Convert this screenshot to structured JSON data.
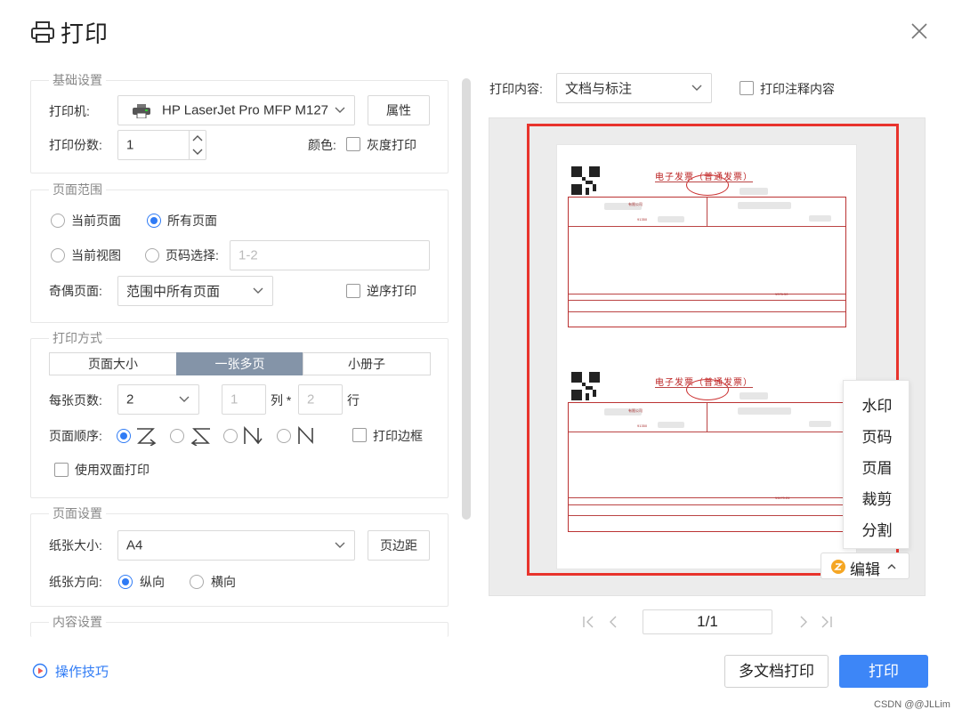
{
  "header": {
    "title": "打印",
    "close_icon": "close-icon"
  },
  "basic": {
    "legend": "基础设置",
    "printer_label": "打印机:",
    "printer_value": "HP LaserJet Pro MFP M127",
    "properties_button": "属性",
    "copies_label": "打印份数:",
    "copies_value": "1",
    "color_label": "颜色:",
    "grayscale_label": "灰度打印",
    "grayscale_checked": false
  },
  "range": {
    "legend": "页面范围",
    "current_page": "当前页面",
    "all_pages": "所有页面",
    "selected": "all_pages",
    "current_view": "当前视图",
    "page_select": "页码选择:",
    "page_select_placeholder": "1-2",
    "odd_even_label": "奇偶页面:",
    "odd_even_value": "范围中所有页面",
    "reverse_label": "逆序打印",
    "reverse_checked": false
  },
  "method": {
    "legend": "打印方式",
    "tabs": [
      "页面大小",
      "一张多页",
      "小册子"
    ],
    "active_tab": "一张多页",
    "per_sheet_label": "每张页数:",
    "per_sheet_value": "2",
    "cols_value": "1",
    "cols_label": "列 *",
    "rows_value": "2",
    "rows_label": "行",
    "order_label": "页面顺序:",
    "order_selected": 0,
    "print_border_label": "打印边框",
    "duplex_label": "使用双面打印"
  },
  "page_setup": {
    "legend": "页面设置",
    "paper_size_label": "纸张大小:",
    "paper_size_value": "A4",
    "margins_button": "页边距",
    "orientation_label": "纸张方向:",
    "portrait": "纵向",
    "landscape": "横向",
    "orientation_selected": "portrait"
  },
  "content_setup": {
    "legend": "内容设置"
  },
  "right": {
    "print_content_label": "打印内容:",
    "print_content_value": "文档与标注",
    "print_comments_label": "打印注释内容"
  },
  "invoice": {
    "title": "电子发票（普通发票）",
    "seller_suffix_1": "有限公司",
    "seller_suffix_2": "有限公司",
    "tax_prefix": "91350",
    "total_1": "¥376.50",
    "total_2": "¥1170.24"
  },
  "edit_menu": {
    "items": [
      "水印",
      "页码",
      "页眉",
      "裁剪",
      "分割"
    ],
    "edit_label": "编辑"
  },
  "pagination": {
    "page": "1/1"
  },
  "footer": {
    "tips": "操作技巧",
    "multi_doc_print": "多文档打印",
    "print": "打印",
    "watermark": "CSDN @@JLLim"
  },
  "colors": {
    "accent": "#3d86f7",
    "highlight_frame": "#e8332c",
    "active_tab": "#8494a8"
  }
}
